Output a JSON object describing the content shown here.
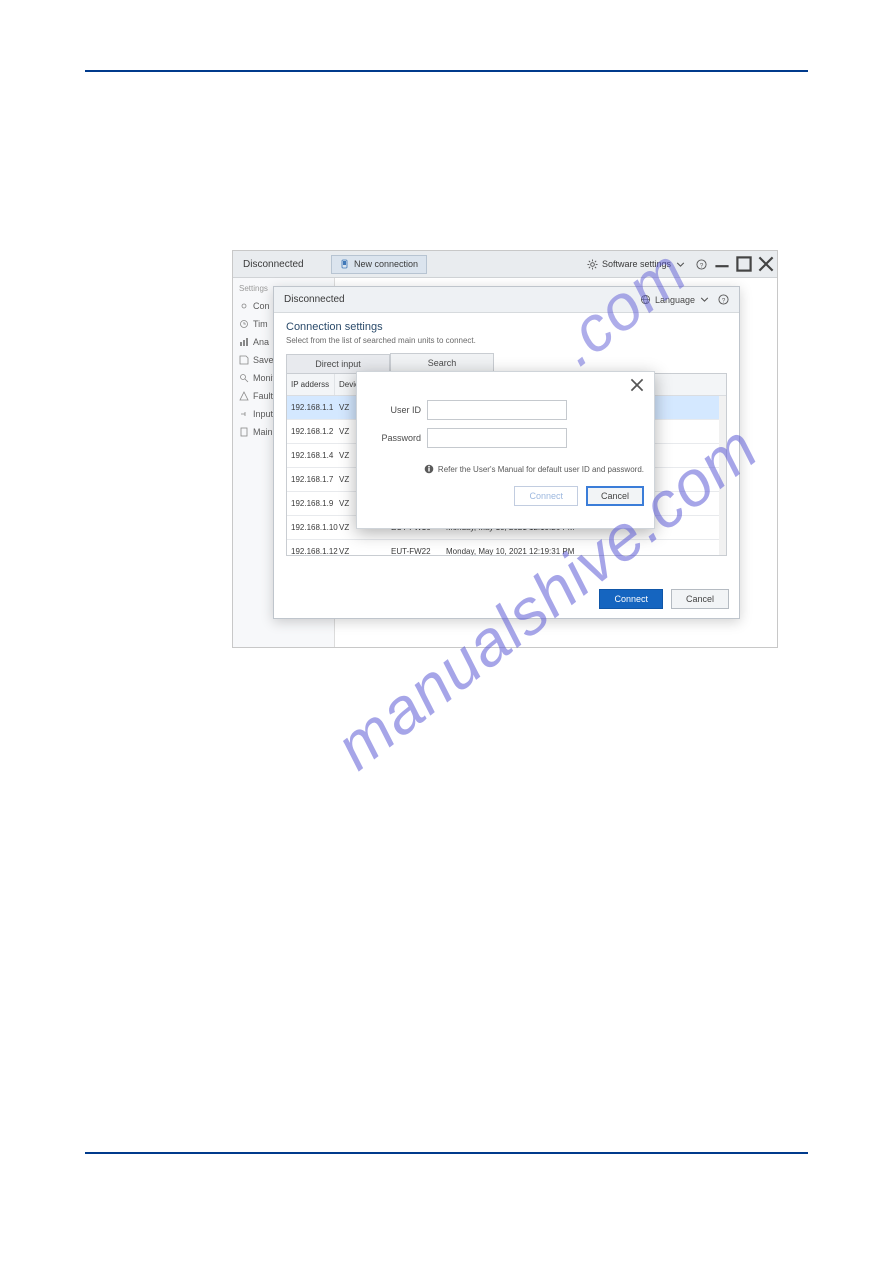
{
  "window": {
    "status": "Disconnected",
    "new_connection": "New connection",
    "software_settings": "Software settings"
  },
  "sidebar": {
    "heading": "Settings",
    "items": [
      {
        "label": "Con"
      },
      {
        "label": "Tim"
      },
      {
        "label": "Ana"
      },
      {
        "label": "Save"
      },
      {
        "label": "Monit"
      },
      {
        "label": "Fault"
      },
      {
        "label": "Input"
      },
      {
        "label": "Main"
      }
    ]
  },
  "dialog": {
    "title": "Disconnected",
    "language": "Language",
    "section_title": "Connection settings",
    "section_sub": "Select from the list of searched main units to connect.",
    "tabs": {
      "direct": "Direct input",
      "search": "Search"
    },
    "columns": {
      "ip": "IP adderss",
      "device": "Devic",
      "eut": "",
      "dt": ""
    },
    "rows": [
      {
        "ip": "192.168.1.1",
        "dev": "VZ",
        "eut": "",
        "dt": ""
      },
      {
        "ip": "192.168.1.2",
        "dev": "VZ",
        "eut": "",
        "dt": ""
      },
      {
        "ip": "192.168.1.4",
        "dev": "VZ",
        "eut": "",
        "dt": ""
      },
      {
        "ip": "192.168.1.7",
        "dev": "VZ",
        "eut": "",
        "dt": ""
      },
      {
        "ip": "192.168.1.9",
        "dev": "VZ",
        "eut": "",
        "dt": ""
      },
      {
        "ip": "192.168.1.10",
        "dev": "VZ",
        "eut": "EUT-FW16",
        "dt": "Monday, May 10, 2021 12:19:26 PM"
      },
      {
        "ip": "192.168.1.12",
        "dev": "VZ",
        "eut": "EUT-FW22",
        "dt": "Monday, May 10, 2021 12:19:31 PM"
      }
    ],
    "buttons": {
      "connect": "Connect",
      "cancel": "Cancel"
    }
  },
  "login": {
    "user_id_label": "User ID",
    "password_label": "Password",
    "user_id_value": "",
    "password_value": "",
    "hint": "Refer the User's Manual for default user ID and password.",
    "connect": "Connect",
    "cancel": "Cancel"
  },
  "watermark": "manualshive.com"
}
